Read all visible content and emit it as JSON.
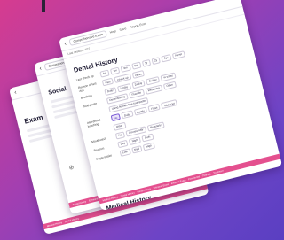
{
  "cards": {
    "back": {
      "title": "Exam"
    },
    "middle": {
      "title": "Social"
    },
    "front": {
      "breadcrumb": "Comprehensive Exam",
      "actions": [
        "Help",
        "Save",
        "Report Error"
      ],
      "subnav": "Last session: 4/27",
      "title": "Dental History",
      "fields": [
        {
          "label": "Last check up",
          "options": [
            "1m",
            "3m",
            "6m",
            "9m",
            "1y",
            "2y",
            "3y+",
            "Never"
          ]
        },
        {
          "label": "Reason of last visit",
          "options": [
            "Pain",
            "Check up",
            "Other"
          ]
        },
        {
          "label": "Brushing",
          "options": [
            "Daily",
            "1x/day",
            "2x/day",
            "3x/day",
            "4+x/day"
          ]
        },
        {
          "label": "Toothpaste",
          "options": [
            "Desensitizing",
            "Fluoride",
            "Whitening",
            "Other"
          ]
        },
        {
          "label": "",
          "options": [
            "Using fluoride free toothpaste"
          ]
        },
        {
          "label": "Interdental brushing",
          "options": [
            "No",
            "Daily",
            "Rarely",
            "Floss",
            "Water jet"
          ]
        },
        {
          "label": "",
          "options": [
            "Other"
          ]
        },
        {
          "label": "Mouthwash",
          "options": [
            "No",
            "Occasionally",
            "Regularly"
          ]
        },
        {
          "label": "Bruxism",
          "options": [
            "Day",
            "Night",
            "Both"
          ]
        },
        {
          "label": "Sugar intake",
          "options": [
            "Low",
            "Med",
            "High"
          ]
        }
      ],
      "tabs": [
        "Medical History",
        "Dental History",
        "Social History",
        "Extraoral Exam",
        "Intraoral Exam",
        "Periodontal",
        "Charting",
        "Treatment"
      ],
      "section_below": "Medical History"
    }
  }
}
